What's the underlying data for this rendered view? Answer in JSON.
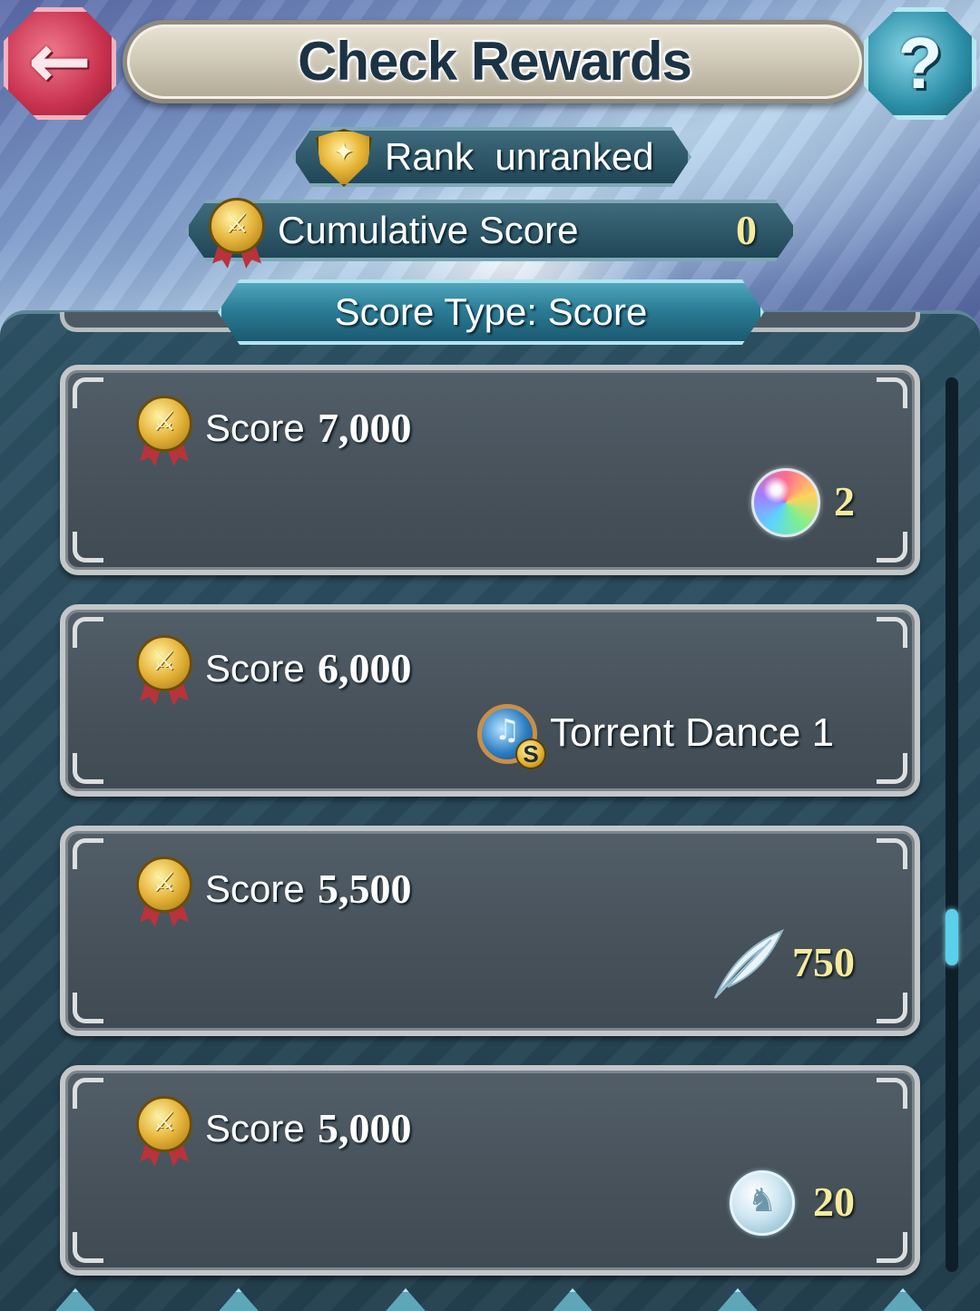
{
  "header": {
    "title": "Check Rewards",
    "back_label": "←",
    "help_label": "?"
  },
  "rank": {
    "label": "Rank",
    "value": "unranked"
  },
  "cumulative": {
    "label": "Cumulative Score",
    "value": "0"
  },
  "score_type": {
    "label": "Score Type: Score"
  },
  "rewards": [
    {
      "score_label": "Score",
      "score_value": "7,000",
      "reward_icon": "rainbow-orb-icon",
      "reward_qty": "2"
    },
    {
      "score_label": "Score",
      "score_value": "6,000",
      "reward_icon": "skill-seal-icon",
      "reward_name": "Torrent Dance 1",
      "badge": "S"
    },
    {
      "score_label": "Score",
      "score_value": "5,500",
      "reward_icon": "feather-icon",
      "reward_qty": "750"
    },
    {
      "score_label": "Score",
      "score_value": "5,000",
      "reward_icon": "silver-coin-icon",
      "reward_qty": "20"
    }
  ],
  "colors": {
    "accent_teal": "#2b7d96",
    "back_red": "#c9324f",
    "qty_yellow": "#f6eb9a",
    "card_gray": "#47525b"
  },
  "scroll": {
    "position_fraction": 0.6
  }
}
